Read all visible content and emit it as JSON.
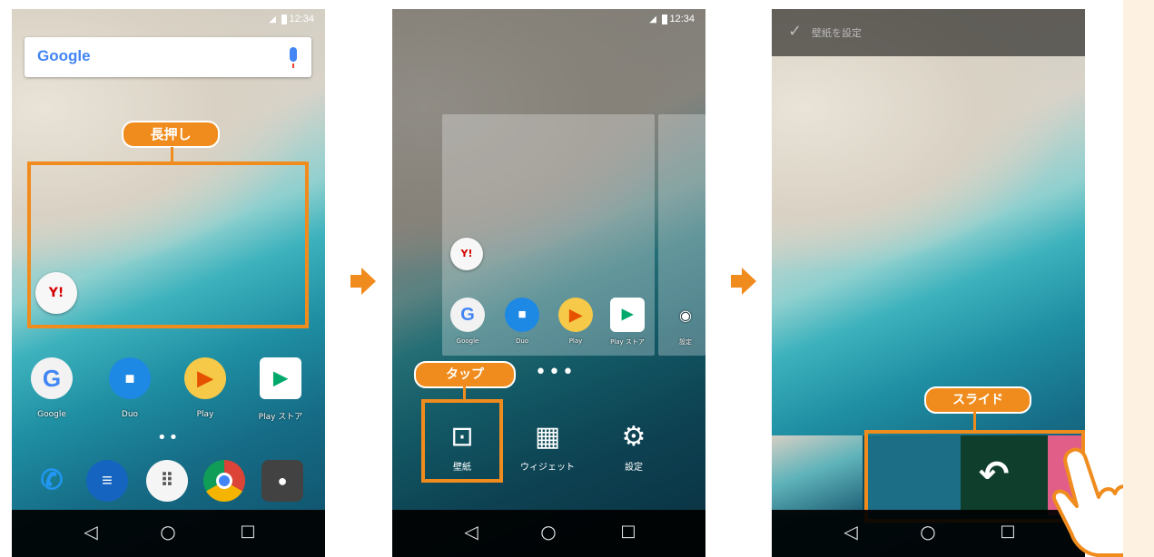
{
  "status": {
    "time": "12:34"
  },
  "screen1": {
    "search_logo": "Google",
    "callout": "長押し",
    "apps": [
      {
        "label": "Google",
        "icon": "google-icon",
        "glyph": "G"
      },
      {
        "label": "Duo",
        "icon": "duo-icon",
        "glyph": "■"
      },
      {
        "label": "Play",
        "icon": "play-games-icon",
        "glyph": "▶"
      },
      {
        "label": "Play ストア",
        "icon": "play-store-icon",
        "glyph": "▶"
      }
    ],
    "dock": [
      {
        "icon": "phone-icon",
        "glyph": "✆"
      },
      {
        "icon": "messages-icon",
        "glyph": "≡"
      },
      {
        "icon": "app-drawer-icon",
        "glyph": "⠿"
      },
      {
        "icon": "chrome-icon",
        "glyph": ""
      },
      {
        "icon": "camera-icon",
        "glyph": "●"
      }
    ],
    "widget_text": "Y!"
  },
  "screen2": {
    "callout": "タップ",
    "card_apps": [
      {
        "label": "Google",
        "glyph": "G"
      },
      {
        "label": "Duo",
        "glyph": "■"
      },
      {
        "label": "Play",
        "glyph": "▶"
      },
      {
        "label": "Play ストア",
        "glyph": "▶"
      },
      {
        "label": "設定",
        "glyph": "◉"
      }
    ],
    "menu": [
      {
        "label": "壁紙",
        "icon": "wallpaper-icon",
        "glyph": "⊡"
      },
      {
        "label": "ウィジェット",
        "icon": "widgets-icon",
        "glyph": "▦"
      },
      {
        "label": "設定",
        "icon": "settings-icon",
        "glyph": "⚙"
      }
    ],
    "widget_text": "Y!"
  },
  "screen3": {
    "callout": "スライド",
    "header_label": "壁紙を設定"
  },
  "nav": {
    "back": "◁",
    "home": "○",
    "recent": "□"
  },
  "colors": {
    "accent": "#f08c1e"
  }
}
